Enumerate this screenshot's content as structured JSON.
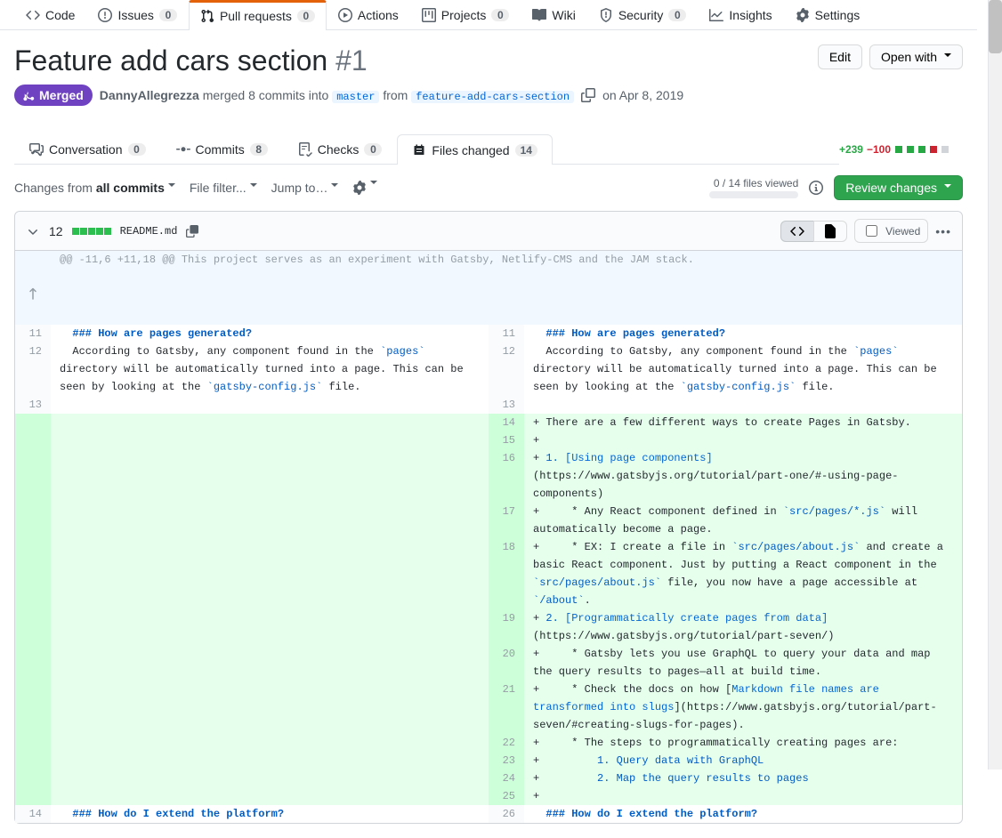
{
  "repo_nav": {
    "code": "Code",
    "issues": "Issues",
    "issues_count": "0",
    "pulls": "Pull requests",
    "pulls_count": "0",
    "actions": "Actions",
    "projects": "Projects",
    "projects_count": "0",
    "wiki": "Wiki",
    "security": "Security",
    "security_count": "0",
    "insights": "Insights",
    "settings": "Settings"
  },
  "pr": {
    "title": "Feature add cars section",
    "number": "#1",
    "edit": "Edit",
    "open_with": "Open with",
    "state": "Merged",
    "author": "DannyAllegrezza",
    "merge_text_1": "merged 8 commits into",
    "base_branch": "master",
    "merge_text_2": "from",
    "head_branch": "feature-add-cars-section",
    "date": "on Apr 8, 2019"
  },
  "tabs": {
    "conversation": "Conversation",
    "conversation_count": "0",
    "commits": "Commits",
    "commits_count": "8",
    "checks": "Checks",
    "checks_count": "0",
    "files": "Files changed",
    "files_count": "14"
  },
  "diffstat": {
    "additions": "+239",
    "deletions": "−100"
  },
  "toolbar": {
    "changes_from_1": "Changes from ",
    "changes_from_2": "all commits",
    "file_filter": "File filter...",
    "jump_to": "Jump to…",
    "viewed": "0 / 14 files viewed",
    "review": "Review changes"
  },
  "file": {
    "changes": "12",
    "name": "README.md",
    "viewed_label": "Viewed"
  },
  "hunk": "@@ -11,6 +11,18 @@ This project serves as an experiment with Gatsby, Netlify-CMS and the JAM stack.",
  "left": {
    "l11": "11",
    "l12": "12",
    "l13": "13",
    "l14": "14",
    "heading11": "### How are pages generated?",
    "line12a": "According to Gatsby, any component found in the ",
    "line12b": "`pages`",
    "line12c": " directory will be automatically turned into a page. This can be seen by looking at the ",
    "line12d": "`gatsby-config.js`",
    "line12e": " file.",
    "heading14": "### How do I extend the platform?"
  },
  "right": {
    "l11": "11",
    "l12": "12",
    "l13": "13",
    "l14": "14",
    "l15": "15",
    "l16": "16",
    "l17": "17",
    "l18": "18",
    "l19": "19",
    "l20": "20",
    "l21": "21",
    "l22": "22",
    "l23": "23",
    "l24": "24",
    "l25": "25",
    "l26": "26",
    "heading11": "### How are pages generated?",
    "line12a": "According to Gatsby, any component found in the ",
    "line12b": "`pages`",
    "line12c": " directory will be automatically turned into a page. This can be seen by looking at the ",
    "line12d": "`gatsby-config.js`",
    "line12e": " file.",
    "a14": "There are a few different ways to create Pages in Gatsby.",
    "a16_num": "1. ",
    "a16_link": "[Using page components]",
    "a16_rest": "(https://www.gatsbyjs.org/tutorial/part-one/#-using-page-components)",
    "a17_pre": "    * Any React component defined in ",
    "a17_code": "`src/pages/*.js`",
    "a17_post": " will automatically become a page.",
    "a18_pre": "    * EX: I create a file in ",
    "a18_code1": "`src/pages/about.js`",
    "a18_mid": " and create a basic React component. Just by putting a React component in the ",
    "a18_code2": "`src/pages/about.js`",
    "a18_mid2": " file, you now have a page accessible at ",
    "a18_code3": "`/about`",
    "a18_end": ".",
    "a19_num": "2. ",
    "a19_link": "[Programmatically create pages from data]",
    "a19_rest": "(https://www.gatsbyjs.org/tutorial/part-seven/)",
    "a20": "    * Gatsby lets you use GraphQL to query your data and map the query results to pages—all at build time.",
    "a21_pre": "    * Check the docs on how [",
    "a21_link": "Markdown file names are transformed into slugs",
    "a21_post": "](https://www.gatsbyjs.org/tutorial/part-seven/#creating-slugs-for-pages).",
    "a22": "    * The steps to programmatically creating pages are:",
    "a23": "        1. Query data with GraphQL",
    "a24": "        2. Map the query results to pages",
    "heading26": "### How do I extend the platform?"
  }
}
